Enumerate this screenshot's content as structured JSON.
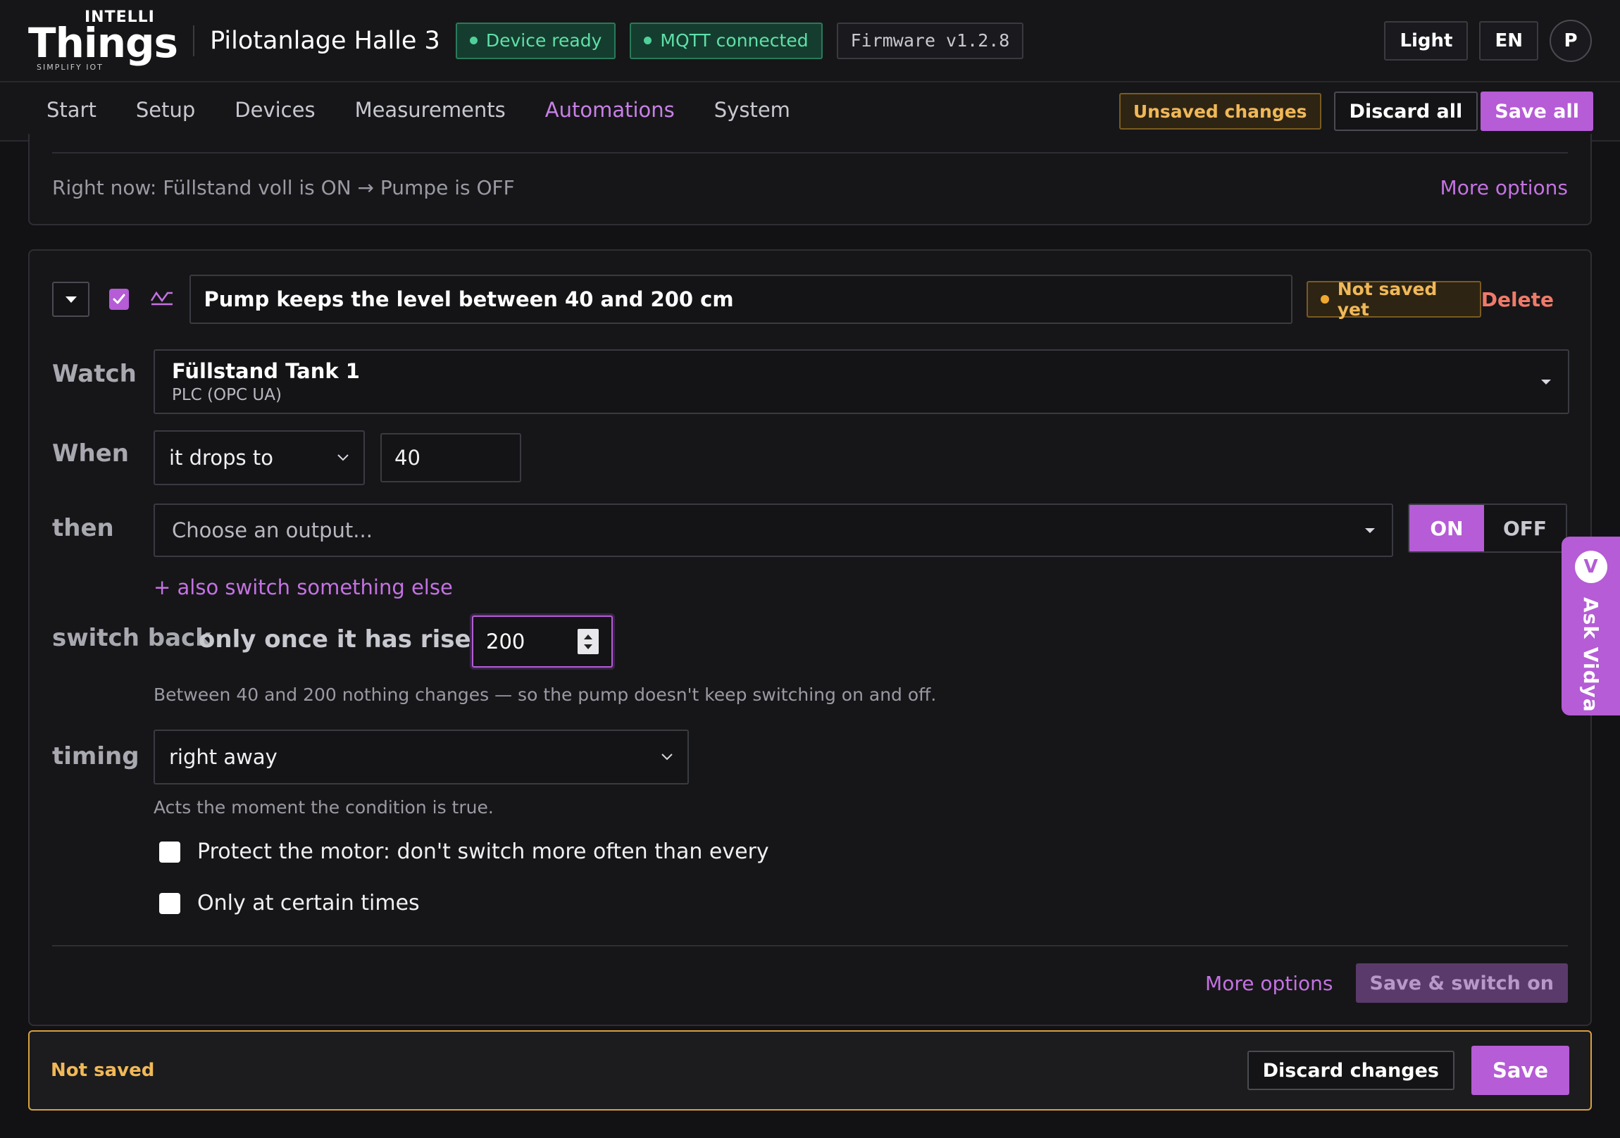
{
  "header": {
    "logo": {
      "top": "INTELLI",
      "main": "Things",
      "sub": "SIMPLIFY IOT"
    },
    "site_title": "Pilotanlage Halle 3",
    "badges": {
      "device": "Device ready",
      "mqtt": "MQTT connected",
      "firmware": "Firmware v1.2.8"
    },
    "theme_label": "Light",
    "language_label": "EN",
    "avatar_initial": "P"
  },
  "nav": {
    "tabs": [
      {
        "label": "Start"
      },
      {
        "label": "Setup"
      },
      {
        "label": "Devices"
      },
      {
        "label": "Measurements"
      },
      {
        "label": "Automations",
        "active": true
      },
      {
        "label": "System"
      }
    ],
    "unsaved_label": "Unsaved changes",
    "discard_all_label": "Discard all",
    "save_all_label": "Save all"
  },
  "previous_rule": {
    "status_text": "Right now: Füllstand voll is ON → Pumpe is OFF",
    "more_options_label": "More options"
  },
  "rule": {
    "enabled": true,
    "name": "Pump keeps the level between 40 and 200 cm",
    "status_label": "Not saved yet",
    "delete_label": "Delete",
    "watch": {
      "label": "Watch",
      "name": "Füllstand Tank 1",
      "source": "PLC (OPC UA)"
    },
    "when": {
      "label": "When",
      "condition": "it drops to",
      "value": "40"
    },
    "then": {
      "label": "then",
      "output_placeholder": "Choose an output...",
      "on_label": "ON",
      "off_label": "OFF",
      "selected_state": "ON",
      "also_link": "+ also switch something else"
    },
    "switch_back": {
      "label": "switch back",
      "text": "only once it has risen to",
      "value": "200",
      "help": "Between 40 and 200 nothing changes — so the pump doesn't keep switching on and off."
    },
    "timing": {
      "label": "timing",
      "value": "right away",
      "help": "Acts the moment the condition is true."
    },
    "options": {
      "protect_motor": {
        "label": "Protect the motor: don't switch more often than every",
        "checked": false
      },
      "certain_times": {
        "label": "Only at certain times",
        "checked": false
      }
    },
    "footer": {
      "more_options_label": "More options",
      "save_switch_label": "Save & switch on"
    }
  },
  "save_bar": {
    "status": "Not saved",
    "discard_label": "Discard changes",
    "save_label": "Save"
  },
  "assistant": {
    "logo_letter": "V",
    "label": "Ask Vidya"
  },
  "colors": {
    "accent": "#b55cd6",
    "success": "#5fe0a8",
    "warning": "#f0b858",
    "danger": "#f07a6a",
    "background": "#121214"
  }
}
